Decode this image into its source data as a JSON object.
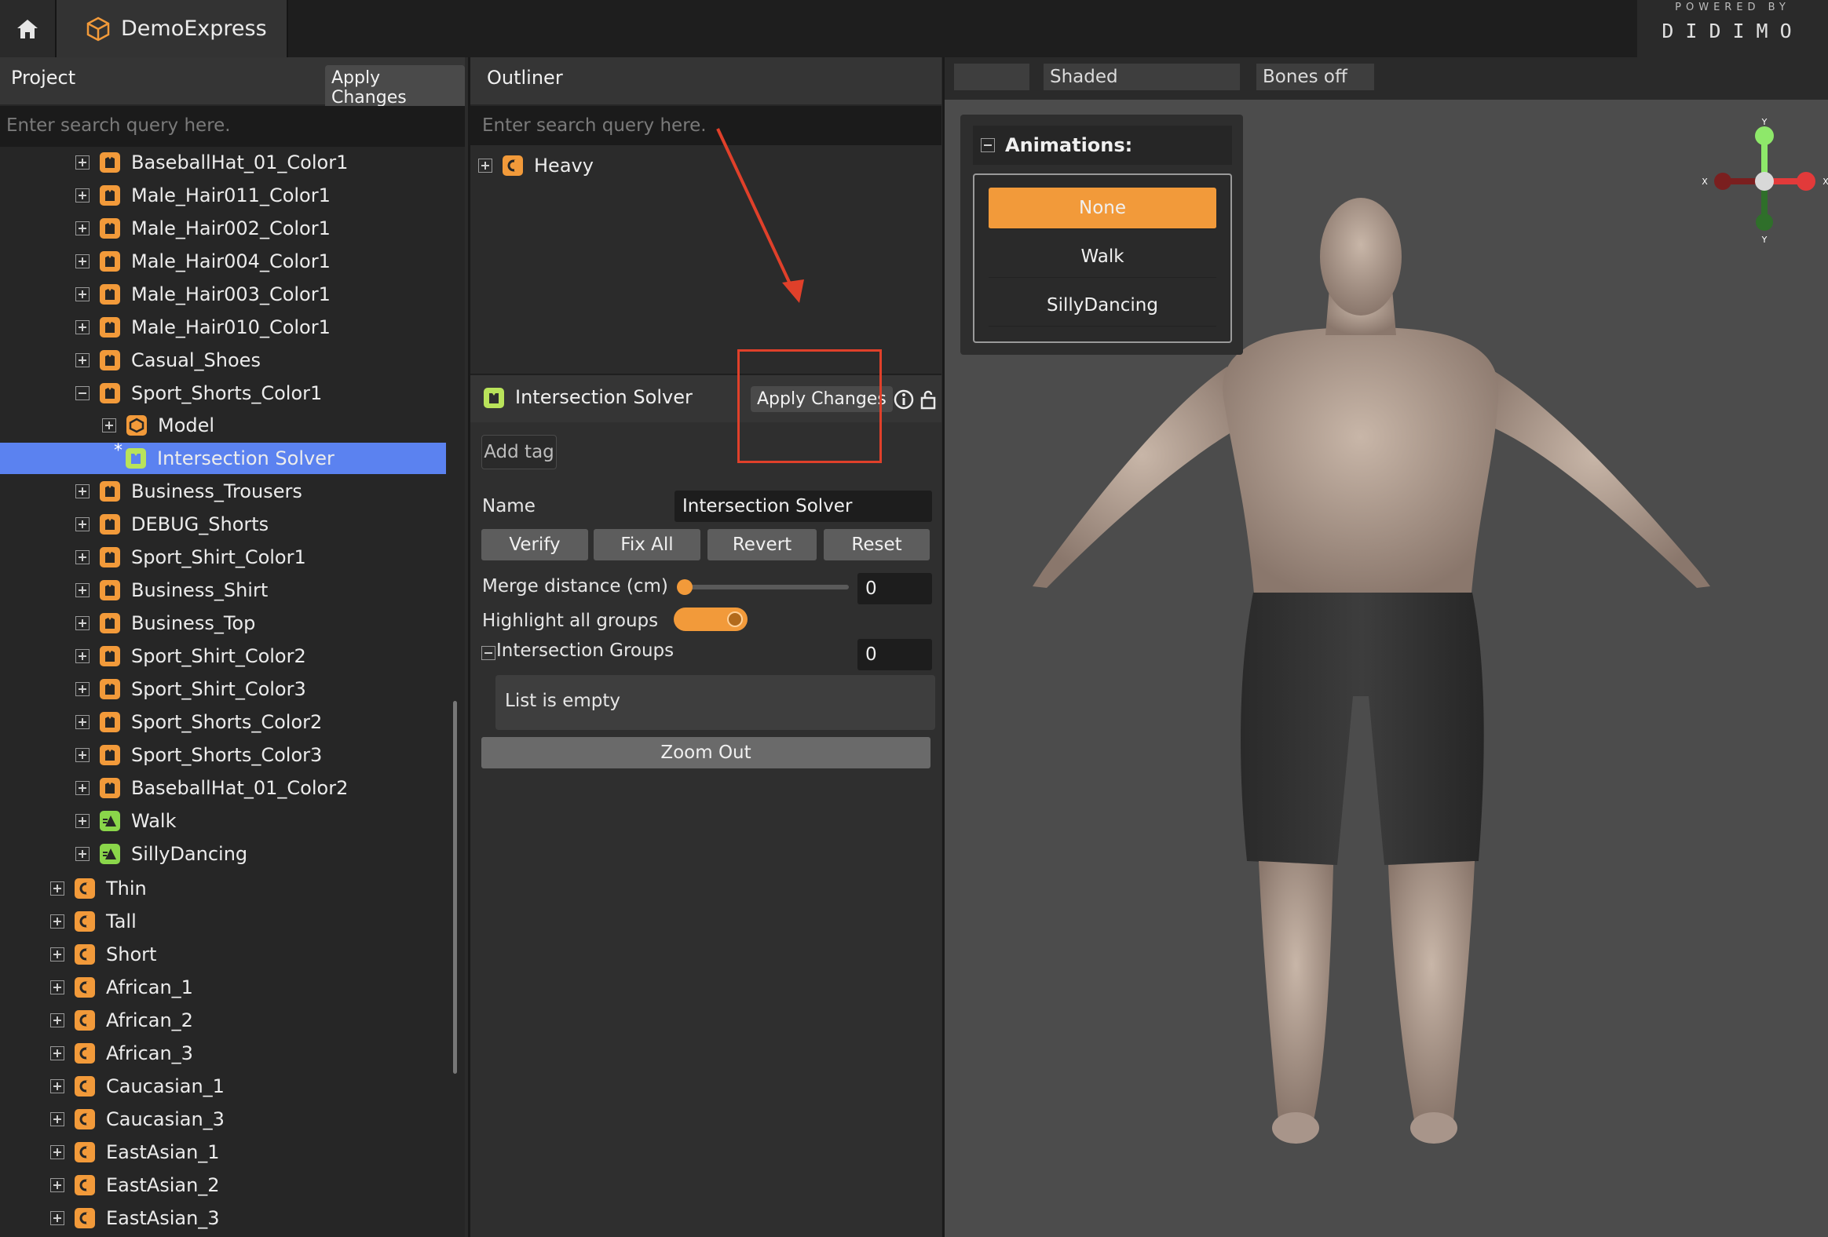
{
  "topbar": {
    "app_name": "DemoExpress",
    "brand_powered": "POWERED BY",
    "brand_name": "DIDIMO"
  },
  "project": {
    "title": "Project",
    "apply_label": "Apply Changes",
    "search_placeholder": "Enter search query here.",
    "items": [
      {
        "label": "BaseballHat_01_Color1",
        "icon": "shirt-icon",
        "exp": "plus"
      },
      {
        "label": "Male_Hair011_Color1",
        "icon": "shirt-icon",
        "exp": "plus"
      },
      {
        "label": "Male_Hair002_Color1",
        "icon": "shirt-icon",
        "exp": "plus"
      },
      {
        "label": "Male_Hair004_Color1",
        "icon": "shirt-icon",
        "exp": "plus"
      },
      {
        "label": "Male_Hair003_Color1",
        "icon": "shirt-icon",
        "exp": "plus"
      },
      {
        "label": "Male_Hair010_Color1",
        "icon": "shirt-icon",
        "exp": "plus"
      },
      {
        "label": "Casual_Shoes",
        "icon": "shirt-icon",
        "exp": "plus"
      },
      {
        "label": "Sport_Shorts_Color1",
        "icon": "shirt-icon",
        "exp": "minus"
      },
      {
        "label": "Model",
        "icon": "model-icon",
        "exp": "plus"
      },
      {
        "label": "Intersection Solver",
        "icon": "solver-icon",
        "exp": "none",
        "modified": "*"
      },
      {
        "label": "Business_Trousers",
        "icon": "shirt-icon",
        "exp": "plus"
      },
      {
        "label": "DEBUG_Shorts",
        "icon": "shirt-icon",
        "exp": "plus"
      },
      {
        "label": "Sport_Shirt_Color1",
        "icon": "shirt-icon",
        "exp": "plus"
      },
      {
        "label": "Business_Shirt",
        "icon": "shirt-icon",
        "exp": "plus"
      },
      {
        "label": "Business_Top",
        "icon": "shirt-icon",
        "exp": "plus"
      },
      {
        "label": "Sport_Shirt_Color2",
        "icon": "shirt-icon",
        "exp": "plus"
      },
      {
        "label": "Sport_Shirt_Color3",
        "icon": "shirt-icon",
        "exp": "plus"
      },
      {
        "label": "Sport_Shorts_Color2",
        "icon": "shirt-icon",
        "exp": "plus"
      },
      {
        "label": "Sport_Shorts_Color3",
        "icon": "shirt-icon",
        "exp": "plus"
      },
      {
        "label": "BaseballHat_01_Color2",
        "icon": "shirt-icon",
        "exp": "plus"
      },
      {
        "label": "Walk",
        "icon": "animation-icon",
        "exp": "plus"
      },
      {
        "label": "SillyDancing",
        "icon": "animation-icon",
        "exp": "plus"
      },
      {
        "label": "Thin",
        "icon": "character-icon",
        "exp": "plus"
      },
      {
        "label": "Tall",
        "icon": "character-icon",
        "exp": "plus"
      },
      {
        "label": "Short",
        "icon": "character-icon",
        "exp": "plus"
      },
      {
        "label": "African_1",
        "icon": "character-icon",
        "exp": "plus"
      },
      {
        "label": "African_2",
        "icon": "character-icon",
        "exp": "plus"
      },
      {
        "label": "African_3",
        "icon": "character-icon",
        "exp": "plus"
      },
      {
        "label": "Caucasian_1",
        "icon": "character-icon",
        "exp": "plus"
      },
      {
        "label": "Caucasian_3",
        "icon": "character-icon",
        "exp": "plus"
      },
      {
        "label": "EastAsian_1",
        "icon": "character-icon",
        "exp": "plus"
      },
      {
        "label": "EastAsian_2",
        "icon": "character-icon",
        "exp": "plus"
      },
      {
        "label": "EastAsian_3",
        "icon": "character-icon",
        "exp": "plus"
      }
    ]
  },
  "outliner": {
    "title": "Outliner",
    "search_placeholder": "Enter search query here.",
    "root_item": "Heavy"
  },
  "inspector": {
    "title": "Intersection Solver",
    "apply_label": "Apply Changes",
    "add_tag": "Add tag",
    "name_label": "Name",
    "name_value": "Intersection Solver",
    "buttons": {
      "verify": "Verify",
      "fix_all": "Fix All",
      "revert": "Revert",
      "reset": "Reset"
    },
    "merge_label": "Merge distance (cm)",
    "merge_value": "0",
    "merge_fraction": 0,
    "highlight_label": "Highlight all groups",
    "highlight_on": true,
    "groups_label": "Intersection Groups",
    "groups_count": "0",
    "list_empty": "List is empty",
    "zoom_out": "Zoom Out"
  },
  "viewport": {
    "shading": "Shaded",
    "bones": "Bones off",
    "animations_title": "Animations:",
    "animations": [
      "None",
      "Walk",
      "SillyDancing"
    ],
    "selected_animation": "None",
    "axis": {
      "y_top": "Y",
      "y_bottom": "Y",
      "x_left": "X",
      "x_right": "X"
    }
  },
  "colors": {
    "accent": "#f29a3a",
    "selection": "#5b82f0",
    "annotation": "#e0402a"
  }
}
